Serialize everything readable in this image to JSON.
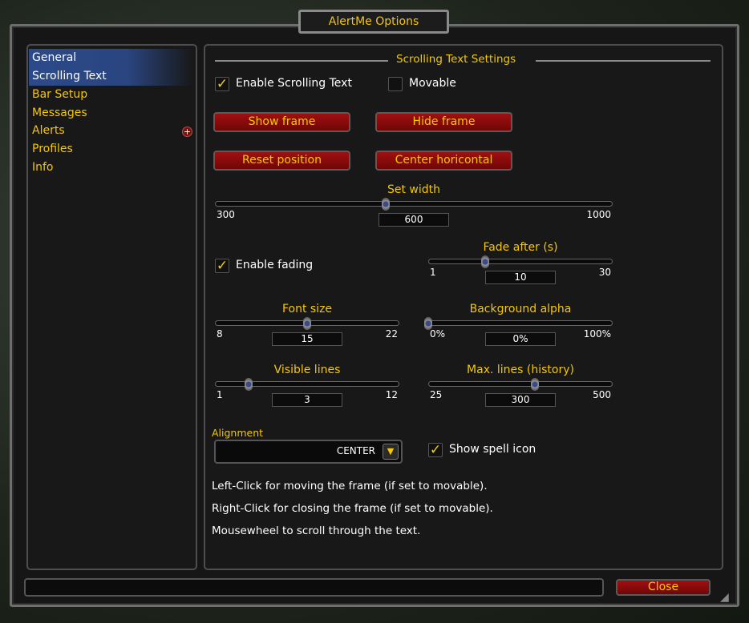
{
  "window": {
    "title": "AlertMe Options"
  },
  "sidebar": {
    "items": [
      {
        "label": "General",
        "selected": false
      },
      {
        "label": "Scrolling Text",
        "selected": true
      },
      {
        "label": "Bar Setup"
      },
      {
        "label": "Messages"
      },
      {
        "label": "Alerts",
        "expand_icon": "plus-icon"
      },
      {
        "label": "Profiles"
      },
      {
        "label": "Info"
      }
    ]
  },
  "main": {
    "section_title": "Scrolling Text Settings",
    "enable_scrolling": {
      "label": "Enable Scrolling Text",
      "checked": true
    },
    "movable": {
      "label": "Movable",
      "checked": false
    },
    "buttons": {
      "show_frame": "Show frame",
      "hide_frame": "Hide frame",
      "reset_position": "Reset position",
      "center_horizontal": "Center horicontal"
    },
    "enable_fading": {
      "label": "Enable fading",
      "checked": true
    },
    "sliders": [
      {
        "label": "Set width",
        "min": 300,
        "max": 1000,
        "value": 600,
        "min_label": "300",
        "max_label": "1000",
        "value_text": "600"
      },
      {
        "label": "Fade after (s)",
        "min": 1,
        "max": 30,
        "value": 10,
        "min_label": "1",
        "max_label": "30",
        "value_text": "10"
      },
      {
        "label": "Font size",
        "min": 8,
        "max": 22,
        "value": 15,
        "min_label": "8",
        "max_label": "22",
        "value_text": "15"
      },
      {
        "label": "Background alpha",
        "min": 0,
        "max": 100,
        "value": 0,
        "min_label": "0%",
        "max_label": "100%",
        "value_text": "0%"
      },
      {
        "label": "Visible lines",
        "min": 1,
        "max": 12,
        "value": 3,
        "min_label": "1",
        "max_label": "12",
        "value_text": "3"
      },
      {
        "label": "Max. lines (history)",
        "min": 25,
        "max": 500,
        "value": 300,
        "min_label": "25",
        "max_label": "500",
        "value_text": "300"
      }
    ],
    "alignment": {
      "label": "Alignment",
      "value": "CENTER"
    },
    "show_spell_icon": {
      "label": "Show spell icon",
      "checked": true
    },
    "info_lines": [
      "Left-Click for moving the frame (if set to movable).",
      "Right-Click for closing the frame (if set to movable).",
      "Mousewheel to scroll through the text."
    ]
  },
  "footer": {
    "close_label": "Close"
  },
  "colors": {
    "accent": "#f5c800",
    "button": "#8a0a0a",
    "selection": "#2c4a8a"
  }
}
